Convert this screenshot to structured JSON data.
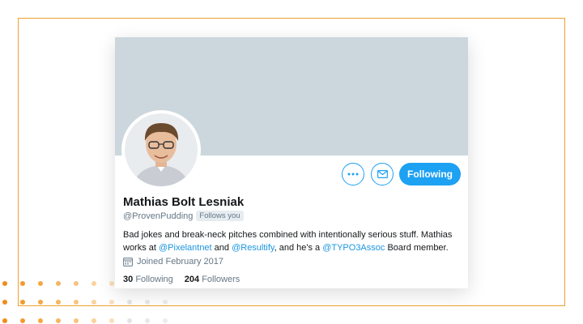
{
  "profile": {
    "name": "Mathias Bolt Lesniak",
    "handle": "@ProvenPudding",
    "follows_you": "Follows you",
    "bio": {
      "p1": "Bad jokes and break-neck pitches combined with intentionally serious stuff. Mathias works at ",
      "m1": "@Pixelantnet",
      "p2": " and ",
      "m2": "@Resultify",
      "p3": ", and he's a ",
      "m3": "@TYPO3Assoc",
      "p4": " Board member."
    },
    "joined": "Joined February 2017",
    "stats": {
      "following_count": "30",
      "following_label": "Following",
      "followers_count": "204",
      "followers_label": "Followers"
    }
  },
  "actions": {
    "more_icon": "more-icon",
    "message_icon": "envelope-icon",
    "following_label": "Following"
  },
  "colors": {
    "accent": "#1da1f2",
    "banner": "#ccd6dd",
    "frame": "#f0a030"
  }
}
